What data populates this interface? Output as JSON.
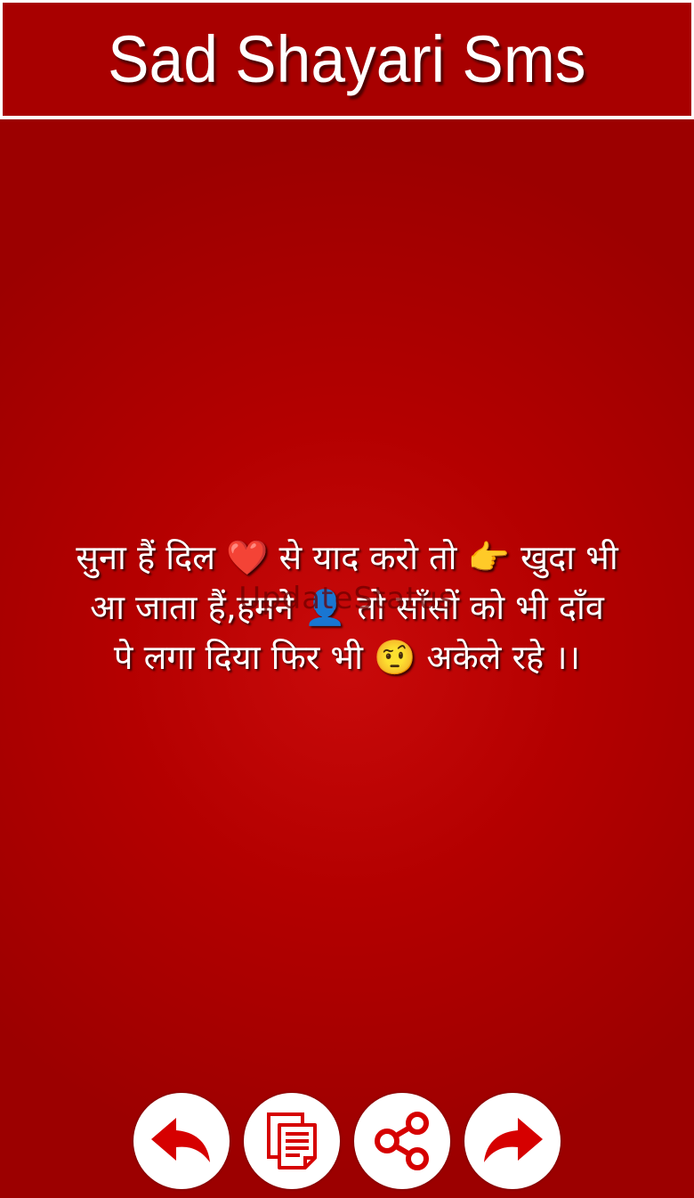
{
  "header": {
    "title": "Sad Shayari Sms"
  },
  "shayari": {
    "lines": [
      "सुना हैं दिल ❤️ से याद करो तो 👉 खुदा भी",
      "आ जाता हैं,हमने 👤 तो साँसों को भी दाँव",
      "पे लगा दिया फिर भी 🤨 अकेले रहे ।।"
    ],
    "watermark": "UpdateStatus"
  },
  "actions": [
    {
      "name": "previous",
      "icon": "reply-arrow-icon"
    },
    {
      "name": "copy",
      "icon": "copy-icon"
    },
    {
      "name": "share",
      "icon": "share-icon"
    },
    {
      "name": "next",
      "icon": "forward-arrow-icon"
    }
  ],
  "colors": {
    "header_bg": "#a80000",
    "background": "#b40000",
    "icon_red": "#d60000"
  }
}
